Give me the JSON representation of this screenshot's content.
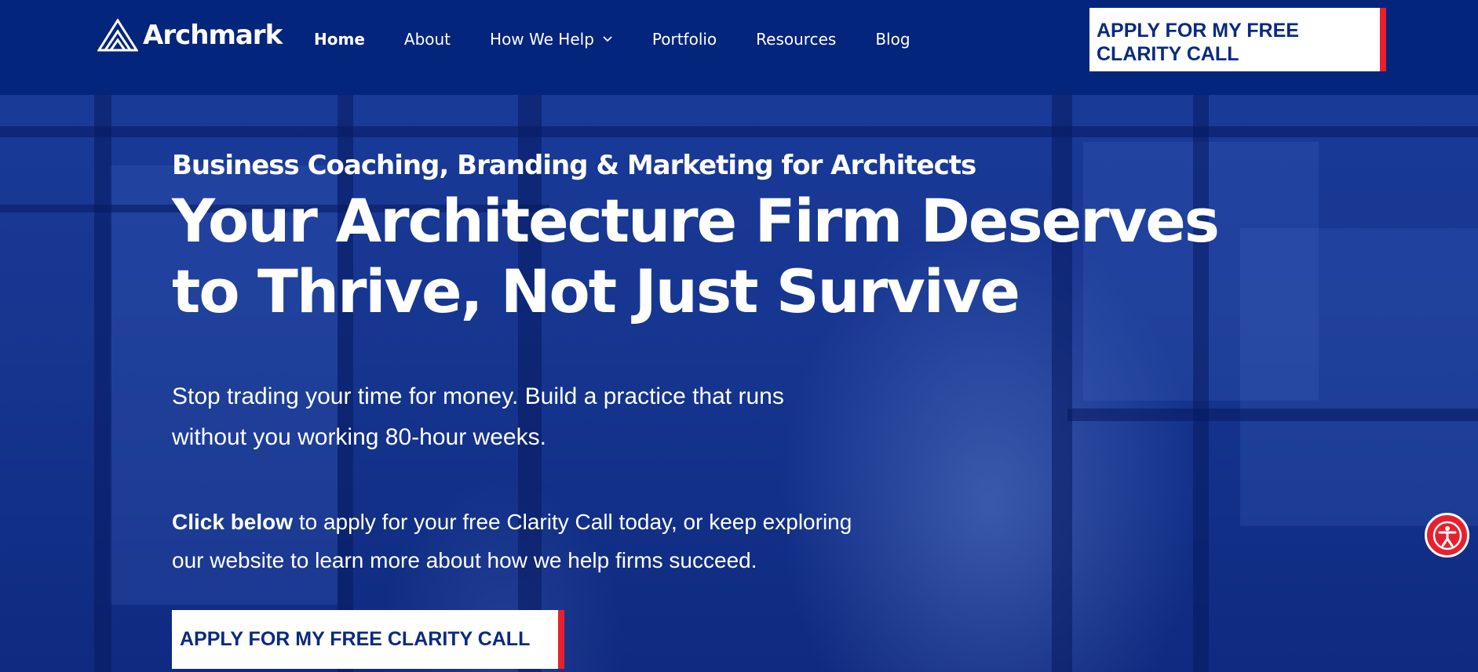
{
  "brand": {
    "name": "Archmark"
  },
  "nav": {
    "items": [
      {
        "label": "Home",
        "active": true
      },
      {
        "label": "About"
      },
      {
        "label": "How We Help",
        "has_dropdown": true
      },
      {
        "label": "Portfolio"
      },
      {
        "label": "Resources"
      },
      {
        "label": "Blog"
      }
    ],
    "cta_line1": "APPLY FOR MY FREE",
    "cta_line2": "CLARITY CALL"
  },
  "hero": {
    "eyebrow": "Business Coaching, Branding & Marketing for Architects",
    "headline_line1": "Your Architecture Firm Deserves",
    "headline_line2": "to Thrive, Not Just Survive",
    "lead_line1": "Stop trading your time for money. Build a practice that runs",
    "lead_line2": "without you working 80-hour weeks.",
    "secondary_bold": "Click below",
    "secondary_rest": " to apply for your free Clarity Call today, or keep exploring",
    "secondary_line2": "our website to learn more about how we help firms succeed.",
    "cta_label": "APPLY FOR MY FREE CLARITY CALL"
  },
  "icons": {
    "logo": "archmark-logo-icon",
    "dropdown": "chevron-down-icon",
    "accessibility": "accessibility-icon"
  },
  "colors": {
    "header_bg": "#03257c",
    "hero_bg": "#15358f",
    "cta_bg": "#ffffff",
    "cta_text": "#0a2a80",
    "cta_accent": "#e8202e",
    "a11y_bg": "#e8202e"
  }
}
